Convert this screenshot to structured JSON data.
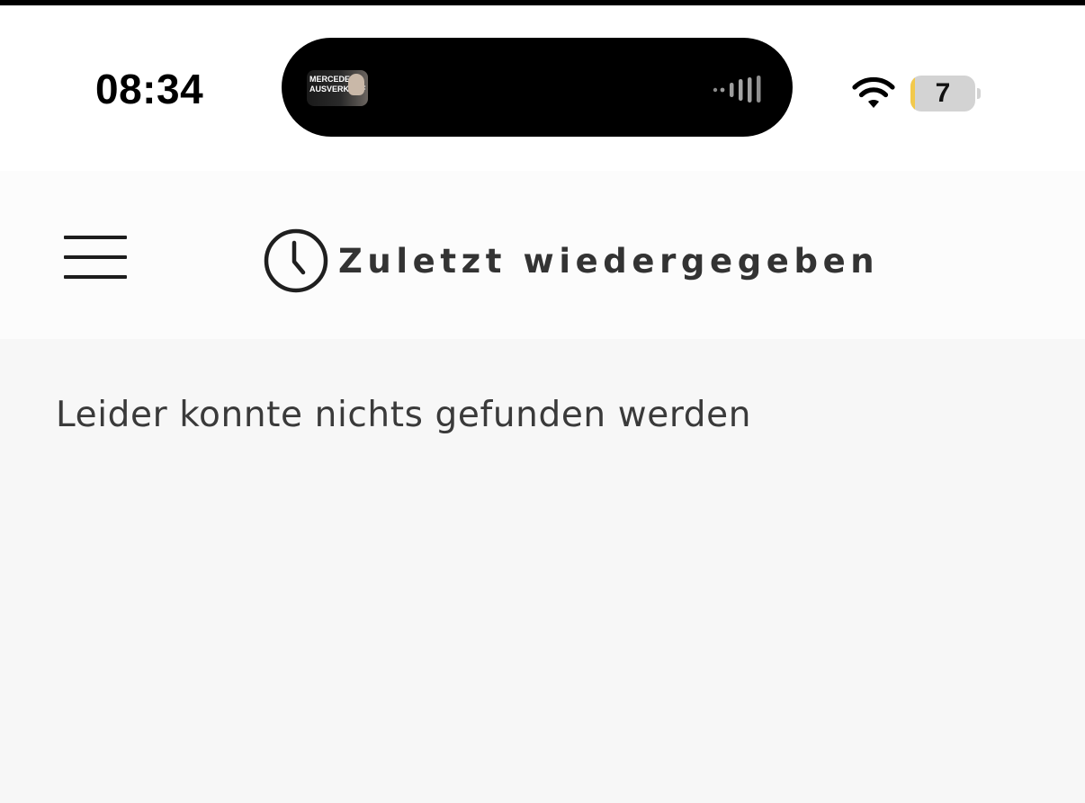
{
  "status_bar": {
    "time": "08:34",
    "battery_level": "7",
    "wifi_icon": "wifi-icon",
    "battery_fill_fraction": 0.07
  },
  "dynamic_island": {
    "now_playing_thumbnail_text": "MERCEDES AUSVERKAUF",
    "waveform_icon": "audio-waveform-icon"
  },
  "header": {
    "menu_icon": "hamburger-menu-icon",
    "title_icon": "clock-icon",
    "title": "Zuletzt wiedergegeben"
  },
  "content": {
    "empty_message": "Leider konnte nichts gefunden werden"
  },
  "colors": {
    "battery_low": "#f2c94c",
    "text_dark": "#333333",
    "header_background": "#fcfcfc",
    "content_background": "#f7f7f7"
  }
}
